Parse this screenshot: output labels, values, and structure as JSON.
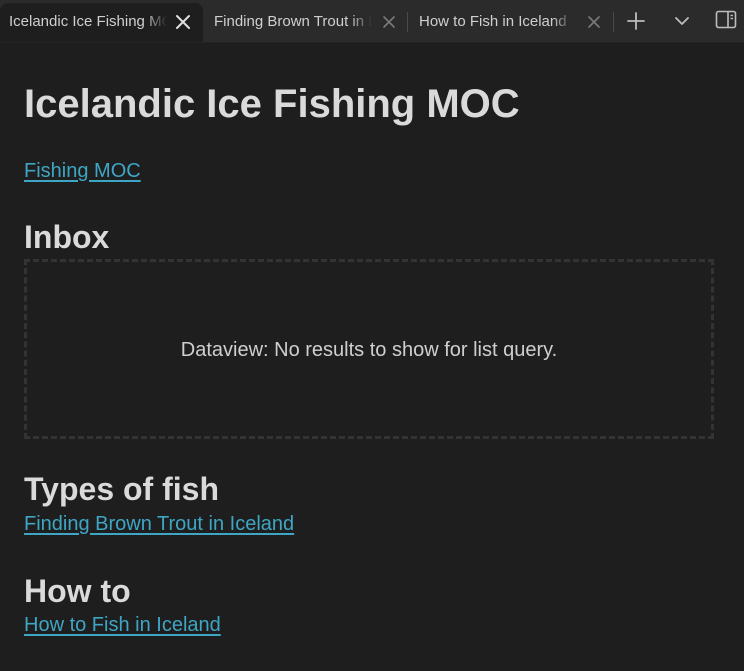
{
  "tabs": [
    {
      "title": "Icelandic Ice Fishing MOC",
      "active": true,
      "close_icon": "close-icon"
    },
    {
      "title": "Finding Brown Trout in Iceland",
      "active": false,
      "close_icon": "close-icon"
    },
    {
      "title": "How to Fish in Iceland",
      "active": false,
      "close_icon": "close-icon"
    }
  ],
  "toolbar": {
    "new_tab_icon": "plus-icon",
    "tab_list_icon": "chevron-down-icon",
    "sidebar_toggle_icon": "sidebar-right-icon"
  },
  "note": {
    "title": "Icelandic Ice Fishing MOC",
    "parent_link": "Fishing MOC",
    "sections": {
      "inbox": {
        "heading": "Inbox",
        "dataview_message": "Dataview: No results to show for list query."
      },
      "types": {
        "heading": "Types of fish",
        "link": "Finding Brown Trout in Iceland"
      },
      "howto": {
        "heading": "How to",
        "link": "How to Fish in Iceland"
      }
    }
  },
  "colors": {
    "background": "#1e1e1e",
    "tabbar": "#2b2b2b",
    "text": "#dadada",
    "link": "#3ea6c4",
    "dashed_border": "#333333"
  }
}
